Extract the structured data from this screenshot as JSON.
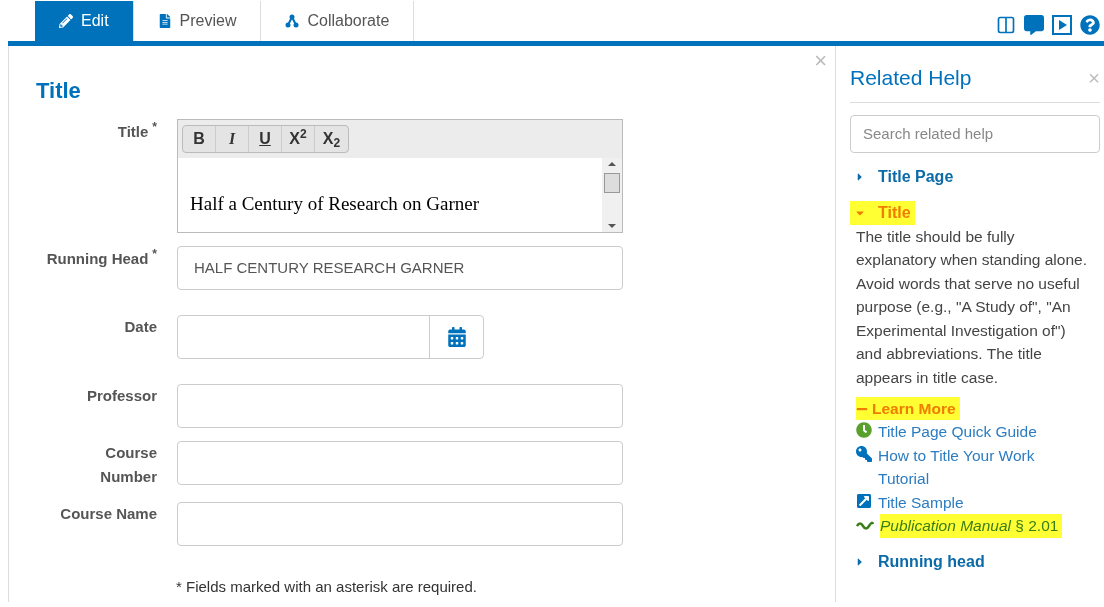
{
  "tabs": [
    {
      "label": "Edit",
      "kind": "pencil",
      "selected": true
    },
    {
      "label": "Preview",
      "kind": "document",
      "selected": false
    },
    {
      "label": "Collaborate",
      "kind": "share",
      "selected": false
    }
  ],
  "form": {
    "close": "×",
    "heading": "Title",
    "fields": [
      {
        "kind": "rich",
        "label": "Title",
        "required_mark": "*",
        "toolbar": [
          "B",
          "I",
          "U",
          "X$^{2}$",
          "X$_{2}$"
        ],
        "value": "Half a Century of Research on Garner"
      },
      {
        "kind": "text",
        "label": "Running Head",
        "required_mark": "*",
        "value": "HALF CENTURY RESEARCH GARNER"
      },
      {
        "kind": "date",
        "label": "Date"
      },
      {
        "kind": "text",
        "label": "Professor"
      },
      {
        "kind": "text",
        "label": "Course Number"
      },
      {
        "kind": "text",
        "label": "Course Name"
      }
    ],
    "note": "* Fields marked with an asterisk are required."
  },
  "help": {
    "title": "Related Help",
    "close": "×",
    "search": {
      "placeholder": "Search related help"
    },
    "sections": [
      {
        "label": "Title Page",
        "expanded": false,
        "highlighted": false
      },
      {
        "label": "Title",
        "expanded": true,
        "highlighted": true,
        "body": "The title should be fully explanatory when standing alone. Avoid words that serve no useful purpose (e.g., \"A Study of\", \"An Experimental Investigation of\") and abbreviations. The title appears in title case.",
        "learn_more": {
          "label": "Learn More",
          "expanded": true,
          "links": [
            {
              "kind": "guide",
              "text": "Title Page Quick Guide",
              "highlighted": false
            },
            {
              "kind": "tutorial",
              "text": "How to Title Your Work Tutorial",
              "highlighted": false
            },
            {
              "kind": "sample",
              "text": "Title Sample",
              "highlighted": false
            },
            {
              "kind": "manual",
              "text": "*Publication Manual* § 2.01",
              "highlighted": true
            }
          ]
        }
      },
      {
        "label": "Running head",
        "expanded": false,
        "highlighted": false
      }
    ]
  }
}
